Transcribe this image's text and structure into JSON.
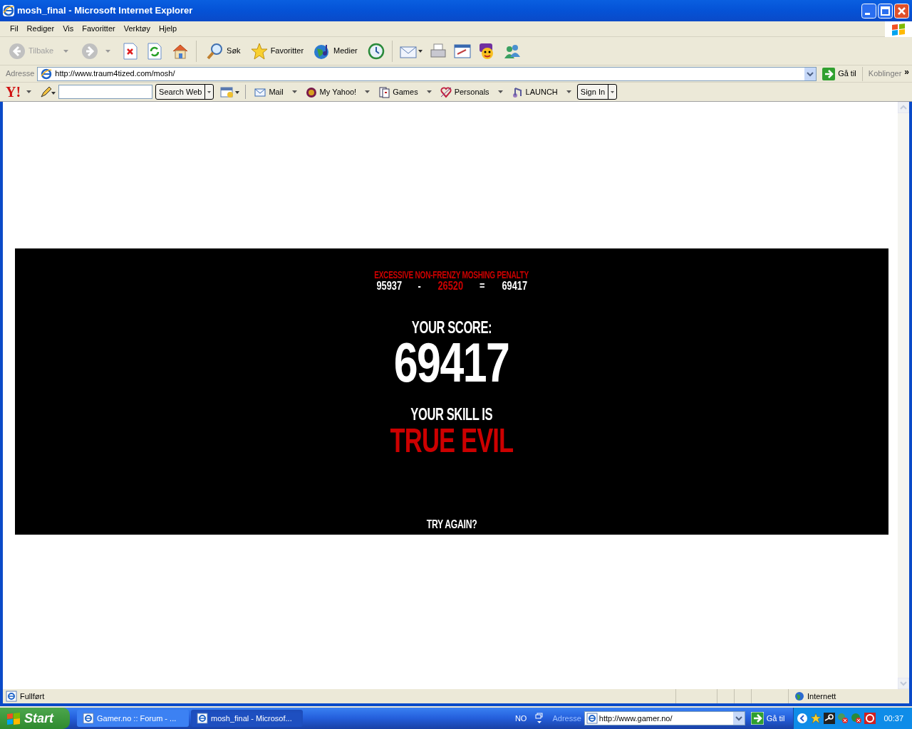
{
  "window": {
    "title": "mosh_final - Microsoft Internet Explorer"
  },
  "menu": [
    "Fil",
    "Rediger",
    "Vis",
    "Favoritter",
    "Verktøy",
    "Hjelp"
  ],
  "nav": {
    "back": {
      "label": "Tilbake",
      "disabled": true
    },
    "forward": {
      "disabled": true
    }
  },
  "toolbar_labels": {
    "search": "Søk",
    "favorites": "Favoritter",
    "media": "Medier"
  },
  "address_bar": {
    "label": "Adresse",
    "value": "http://www.traum4tized.com/mosh/",
    "go": "Gå til",
    "links": "Koblinger",
    "more": "»"
  },
  "yahoo_toolbar": {
    "logo": "Y!",
    "search_button": "Search Web",
    "items": [
      "Mail",
      "My Yahoo!",
      "Games",
      "Personals",
      "LAUNCH"
    ],
    "sign_in": "Sign In"
  },
  "game": {
    "penalty_title": "EXCESSIVE NON-FRENZY MOSHING PENALTY",
    "equation": [
      {
        "text": "95937",
        "color": "#ffffff"
      },
      {
        "text": "-",
        "color": "#ffffff"
      },
      {
        "text": "26520",
        "color": "#cc0000"
      },
      {
        "text": "=",
        "color": "#ffffff"
      },
      {
        "text": "69417",
        "color": "#ffffff"
      }
    ],
    "score_label": "YOUR SCORE:",
    "score": "69417",
    "skill_label": "YOUR SKILL IS",
    "skill": "TRUE EVIL",
    "try_again": "TRY AGAIN?"
  },
  "status_bar": {
    "text": "Fullført",
    "zone": "Internett"
  },
  "taskbar": {
    "start": "Start",
    "tasks": [
      {
        "label": "Gamer.no :: Forum - ...",
        "selected": false
      },
      {
        "label": "mosh_final - Microsof...",
        "selected": true
      }
    ],
    "language": "NO",
    "address_label": "Adresse",
    "address_value": "http://www.gamer.no/",
    "go": "Gå til",
    "clock": "00:37"
  }
}
